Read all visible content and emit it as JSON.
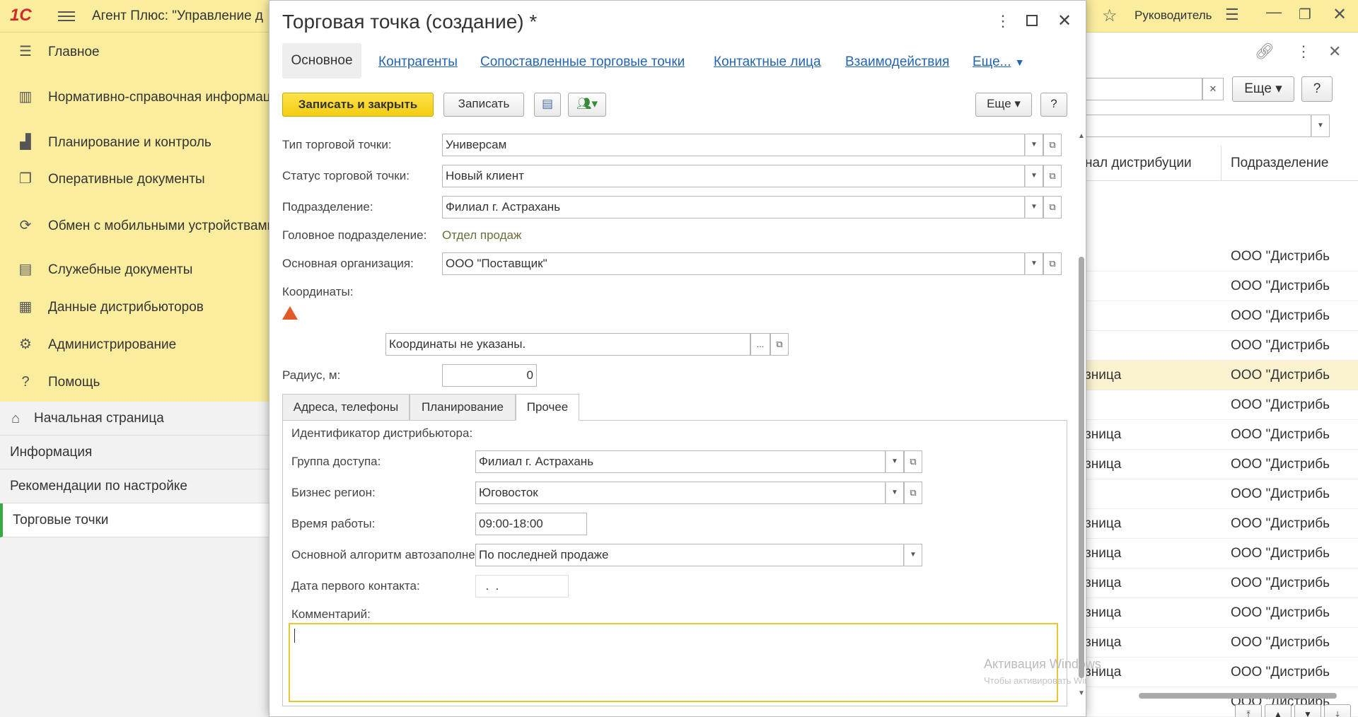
{
  "app": {
    "title": "Агент Плюс: \"Управление д",
    "user": "Руководитель"
  },
  "sidebar": {
    "items": [
      {
        "label": "Главное",
        "icon": "list-icon"
      },
      {
        "label": "Нормативно-справочная информация",
        "icon": "reference-icon"
      },
      {
        "label": "Планирование и контроль",
        "icon": "chart-icon"
      },
      {
        "label": "Оперативные документы",
        "icon": "documents-icon"
      },
      {
        "label": "Обмен с мобильными устройствами",
        "icon": "sync-icon"
      },
      {
        "label": "Служебные документы",
        "icon": "service-docs-icon"
      },
      {
        "label": "Данные дистрибьюторов",
        "icon": "distributor-icon"
      },
      {
        "label": "Администрирование",
        "icon": "gear-icon"
      },
      {
        "label": "Помощь",
        "icon": "help-icon"
      }
    ]
  },
  "nav": {
    "items": [
      "Начальная страница",
      "Информация",
      "Рекомендации по настройке",
      "Торговые точки"
    ]
  },
  "background_list": {
    "more_label": "Еще",
    "help_label": "?",
    "col1_header": "нал дистрибуции",
    "col2_header": "Подразделение",
    "rows": [
      {
        "c1": "",
        "c2": "ООО \"Дистрибь"
      },
      {
        "c1": "",
        "c2": "ООО \"Дистрибь"
      },
      {
        "c1": "",
        "c2": "ООО \"Дистрибь"
      },
      {
        "c1": "",
        "c2": "ООО \"Дистрибь"
      },
      {
        "c1": "зница",
        "c2": "ООО \"Дистрибь"
      },
      {
        "c1": "",
        "c2": "ООО \"Дистрибь"
      },
      {
        "c1": "зница",
        "c2": "ООО \"Дистрибь"
      },
      {
        "c1": "зница",
        "c2": "ООО \"Дистрибь"
      },
      {
        "c1": "",
        "c2": "ООО \"Дистрибь"
      },
      {
        "c1": "зница",
        "c2": "ООО \"Дистрибь"
      },
      {
        "c1": "зница",
        "c2": "ООО \"Дистрибь"
      },
      {
        "c1": "зница",
        "c2": "ООО \"Дистрибь"
      },
      {
        "c1": "зница",
        "c2": "ООО \"Дистрибь"
      },
      {
        "c1": "зница",
        "c2": "ООО \"Дистрибь"
      },
      {
        "c1": "зница",
        "c2": "ООО \"Дистрибь"
      },
      {
        "c1": "",
        "c2": "ООО \"Дистрибь"
      }
    ]
  },
  "dialog": {
    "title": "Торговая точка (создание) *",
    "tabs": [
      "Основное",
      "Контрагенты",
      "Сопоставленные торговые точки",
      "Контактные лица",
      "Взаимодействия",
      "Еще..."
    ],
    "buttons": {
      "save_close": "Записать и закрыть",
      "save": "Записать",
      "more": "Еще",
      "help": "?"
    },
    "fields": {
      "type_label": "Тип торговой точки:",
      "type_value": "Универсам",
      "status_label": "Статус торговой точки:",
      "status_value": "Новый клиент",
      "division_label": "Подразделение:",
      "division_value": "Филиал г. Астрахань",
      "head_division_label": "Головное подразделение:",
      "head_division_value": "Отдел продаж",
      "org_label": "Основная организация:",
      "org_value": "ООО \"Поставщик\"",
      "coords_label": "Координаты:",
      "coords_value": "Координаты не указаны.",
      "coords_select": "...",
      "radius_label": "Радиус, м:",
      "radius_value": "0"
    },
    "subtabs": [
      "Адреса, телефоны",
      "Планирование",
      "Прочее"
    ],
    "other": {
      "distributor_id_label": "Идентификатор дистрибьютора:",
      "access_group_label": "Группа доступа:",
      "access_group_value": "Филиал г. Астрахань",
      "region_label": "Бизнес регион:",
      "region_value": "Юговосток",
      "work_time_label": "Время работы:",
      "work_time_value": "09:00-18:00",
      "autofill_label": "Основной алгоритм автозаполнения:",
      "autofill_value": "По последней продаже",
      "first_contact_label": "Дата первого контакта:",
      "first_contact_value": "  .  .",
      "comment_label": "Комментарий:",
      "comment_value": ""
    },
    "watermark": {
      "line1": "Активация Windows",
      "line2": "Чтобы активировать Windows, перейдите в раздел \"Параметры\"."
    }
  },
  "colors": {
    "accent_yellow": "#fbed9e",
    "primary_button": "#f3cd10",
    "link": "#2464b0",
    "active_nav": "#3aa845",
    "warning": "#e05a2a"
  }
}
